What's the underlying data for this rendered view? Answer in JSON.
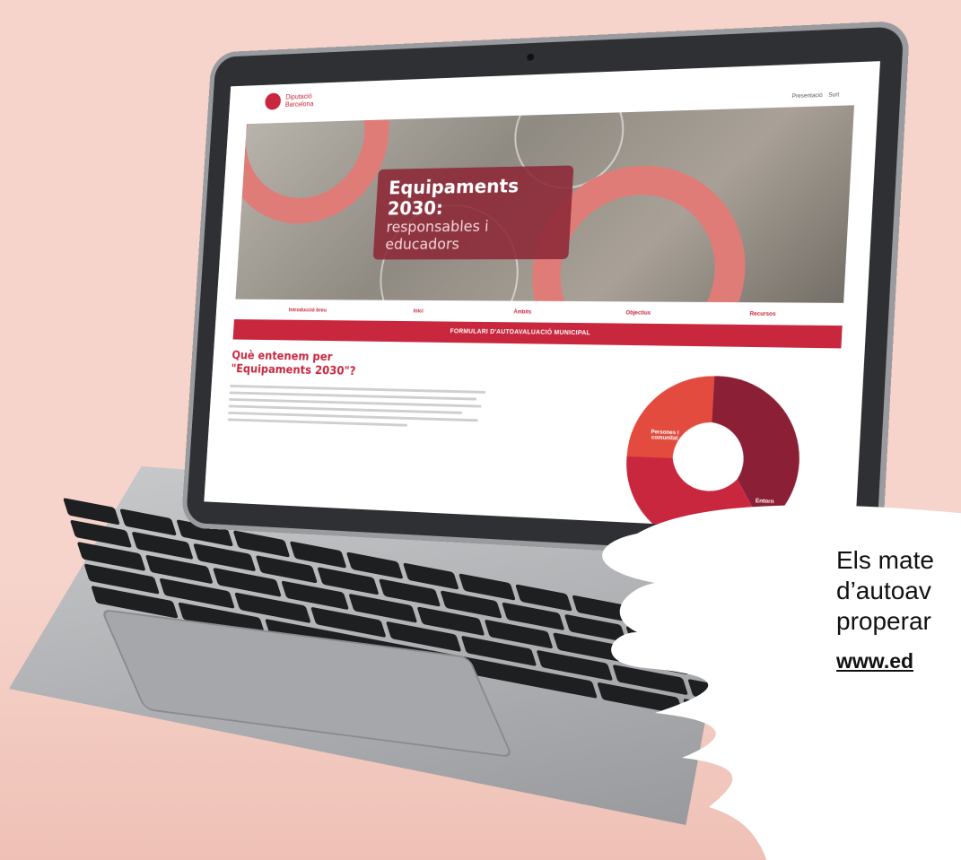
{
  "header": {
    "logo_text": "Diputació Barcelona",
    "nav": [
      "Presentació",
      "Surt"
    ]
  },
  "hero": {
    "title": "Equipaments 2030:",
    "subtitle_line1": "responsables i",
    "subtitle_line2": "educadors"
  },
  "subnav": [
    "Introducció breu",
    "Inici",
    "Àmbits",
    "Objectius",
    "Recursos"
  ],
  "cta_button": "FORMULARI D'AUTOAVALUACIÓ MUNICIPAL",
  "content": {
    "section_title": "Què entenem per \"Equipaments 2030\"?",
    "segments": [
      "Persones i comunitat",
      "Entorn"
    ]
  },
  "bubble": {
    "line1": "Els mate",
    "line2": "d’autoav",
    "line3": "properar",
    "link": "www.ed"
  },
  "colors": {
    "accent": "#c8273e",
    "background": "#f6d4cb",
    "ring": "#e07c78"
  }
}
